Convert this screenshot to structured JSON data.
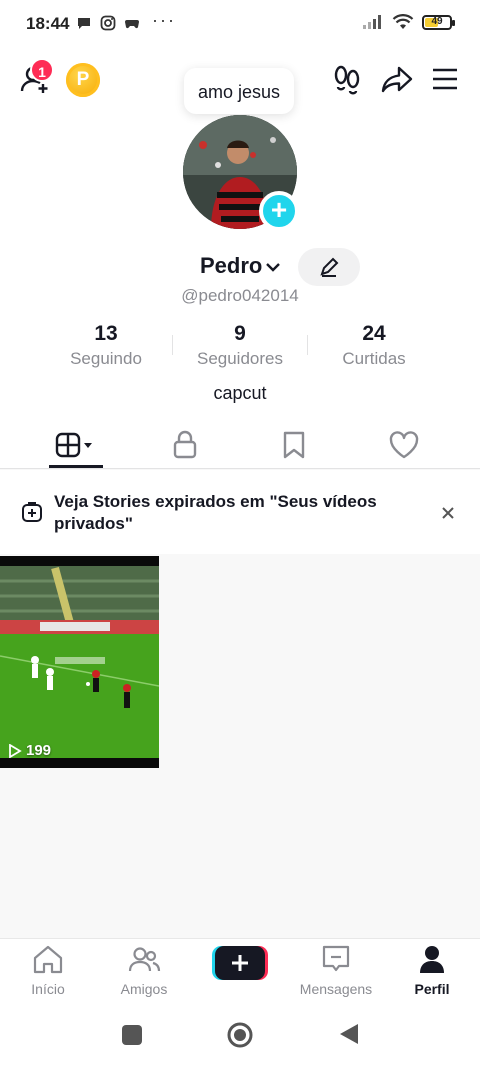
{
  "status_bar": {
    "time": "18:44",
    "dots": "···",
    "battery": "49"
  },
  "top_bar": {
    "notification_count": "1",
    "coin_letter": "P"
  },
  "note_bubble": {
    "text": "amo jesus"
  },
  "profile": {
    "name": "Pedro",
    "handle": "@pedro042014",
    "bio": "capcut",
    "stats": [
      {
        "value": "13",
        "label": "Seguindo"
      },
      {
        "value": "9",
        "label": "Seguidores"
      },
      {
        "value": "24",
        "label": "Curtidas"
      }
    ]
  },
  "tabs": [
    "grid-icon",
    "lock-icon",
    "bookmark-icon",
    "heart-icon"
  ],
  "stories_banner": {
    "text": "Veja Stories expirados em \"Seus vídeos privados\""
  },
  "videos": [
    {
      "views": "199"
    }
  ],
  "bottom_nav": {
    "items": [
      {
        "label": "Início",
        "icon": "home-icon"
      },
      {
        "label": "Amigos",
        "icon": "friends-icon"
      },
      {
        "label": "",
        "icon": "plus-icon"
      },
      {
        "label": "Mensagens",
        "icon": "message-icon"
      },
      {
        "label": "Perfil",
        "icon": "profile-icon"
      }
    ],
    "active": "Perfil"
  },
  "colors": {
    "accent_pink": "#fe2c55",
    "accent_cyan": "#20d5ec",
    "coin": "#f6a800",
    "battery": "#f5cd32"
  }
}
